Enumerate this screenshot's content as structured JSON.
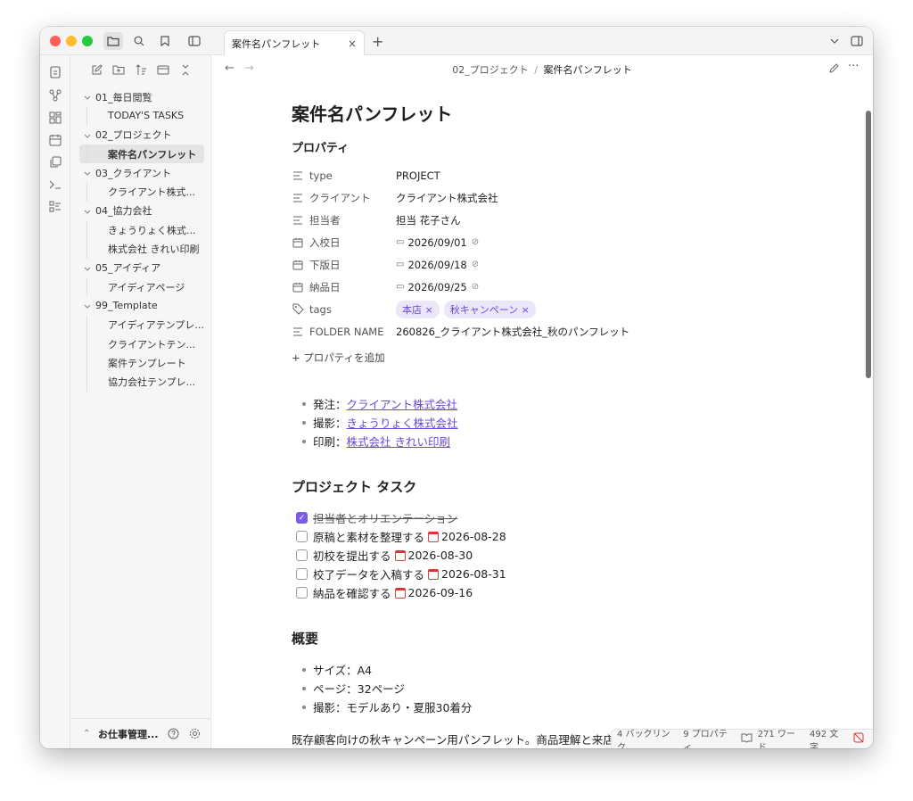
{
  "titlebar": {
    "tab_title": "案件名パンフレット",
    "tab_close": "×",
    "new_tab": "+"
  },
  "sidebar": {
    "tree": [
      {
        "type": "folder",
        "label": "01_毎日閲覧"
      },
      {
        "type": "file",
        "label": "TODAY'S TASKS"
      },
      {
        "type": "folder",
        "label": "02_プロジェクト"
      },
      {
        "type": "file",
        "label": "案件名パンフレット",
        "selected": true
      },
      {
        "type": "folder",
        "label": "03_クライアント"
      },
      {
        "type": "file",
        "label": "クライアント株式..."
      },
      {
        "type": "folder",
        "label": "04_協力会社"
      },
      {
        "type": "file",
        "label": "きょうりょく株式..."
      },
      {
        "type": "file",
        "label": "株式会社 きれい印刷"
      },
      {
        "type": "folder",
        "label": "05_アイディア"
      },
      {
        "type": "file",
        "label": "アイディアページ"
      },
      {
        "type": "folder",
        "label": "99_Template"
      },
      {
        "type": "file",
        "label": "アイディアテンプレ..."
      },
      {
        "type": "file",
        "label": "クライアントテン..."
      },
      {
        "type": "file",
        "label": "案件テンプレート"
      },
      {
        "type": "file",
        "label": "協力会社テンプレ..."
      }
    ],
    "vault_name": "お仕事管理..."
  },
  "nav": {
    "breadcrumb_folder": "02_プロジェクト",
    "breadcrumb_sep": "/",
    "breadcrumb_current": "案件名パンフレット"
  },
  "doc": {
    "title": "案件名パンフレット",
    "properties_heading": "プロパティ",
    "properties": {
      "type_key": "type",
      "type_val": "PROJECT",
      "client_key": "クライアント",
      "client_val": "クライアント株式会社",
      "person_key": "担当者",
      "person_val": "担当 花子さん",
      "date1_key": "入校日",
      "date1_val": "2026/09/01",
      "date2_key": "下版日",
      "date2_val": "2026/09/18",
      "date3_key": "納品日",
      "date3_val": "2026/09/25",
      "tags_key": "tags",
      "tag1": "本店 ×",
      "tag2": "秋キャンペーン ×",
      "folder_key": "FOLDER NAME",
      "folder_val": "260826_クライアント株式会社_秋のパンフレット"
    },
    "add_property": "+ プロパティを追加",
    "links": [
      {
        "prefix": "発注：",
        "text": "クライアント株式会社"
      },
      {
        "prefix": "撮影：",
        "text": "きょうりょく株式会社"
      },
      {
        "prefix": "印刷：",
        "text": "株式会社 きれい印刷"
      }
    ],
    "tasks_heading": "プロジェクト タスク",
    "tasks": [
      {
        "text": "担当者とオリエンテーション",
        "date": "",
        "done": true
      },
      {
        "text": "原稿と素材を整理する",
        "date": "2026-08-28",
        "done": false
      },
      {
        "text": "初校を提出する",
        "date": "2026-08-30",
        "done": false
      },
      {
        "text": "校了データを入稿する",
        "date": "2026-08-31",
        "done": false
      },
      {
        "text": "納品を確認する",
        "date": "2026-09-16",
        "done": false
      }
    ],
    "overview_heading": "概要",
    "overview": [
      "サイズ：A4",
      "ページ：32ページ",
      "撮影：モデルあり・夏服30着分"
    ],
    "paragraph": "既存顧客向けの秋キャンペーン用パンフレット。商品理解と来店"
  },
  "status": {
    "backlinks": "4 バックリンク",
    "properties": "9 プロパティ",
    "words": "271 ワード",
    "chars": "492 文字"
  },
  "colors": {
    "accent": "#7b5ce6",
    "link": "#6a47d8"
  }
}
